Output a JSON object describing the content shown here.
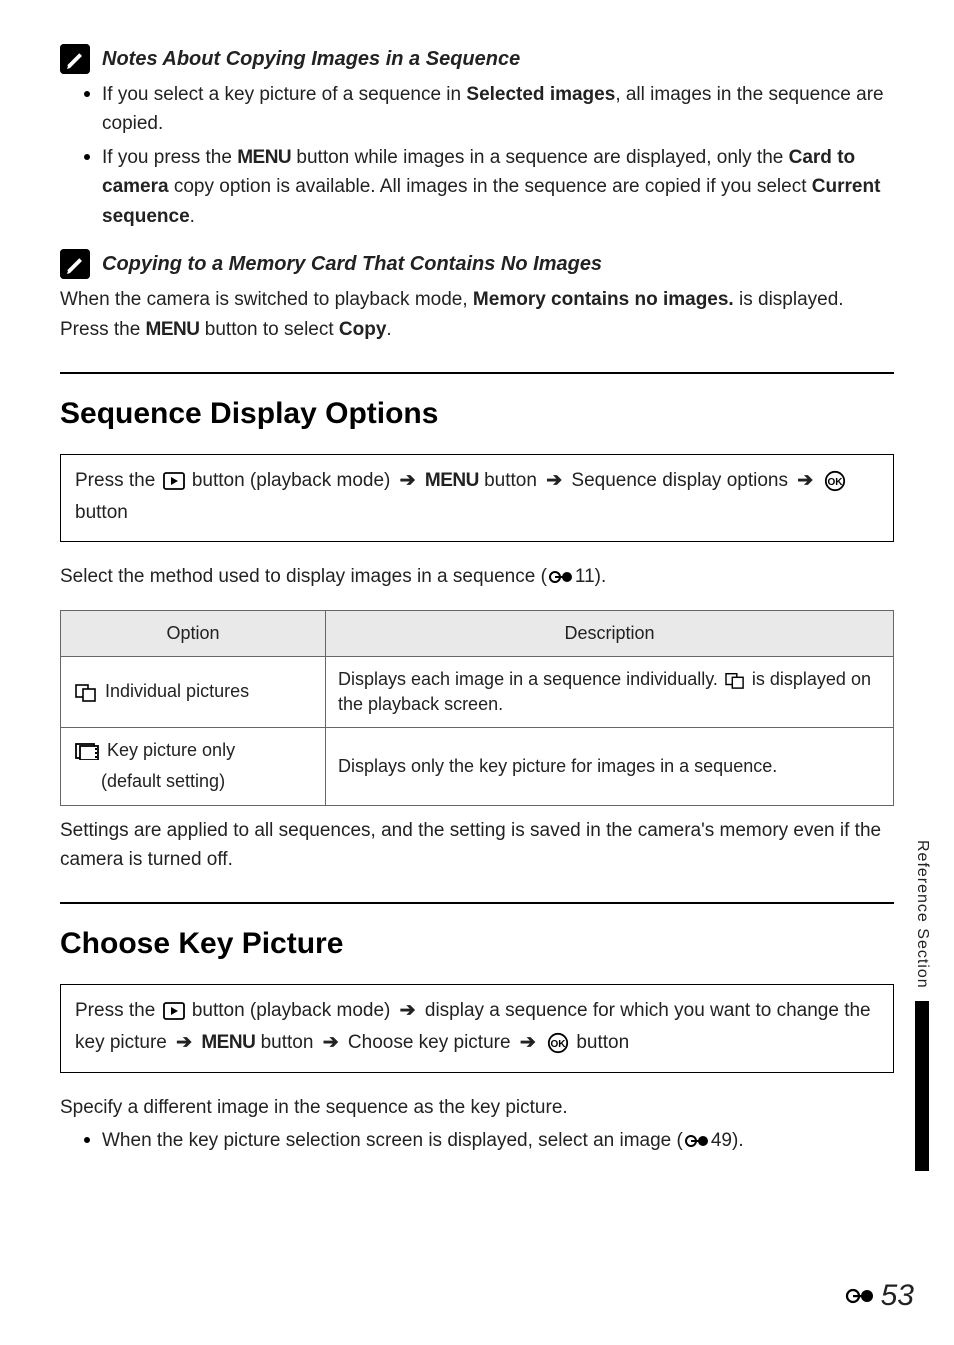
{
  "notes1": {
    "heading": "Notes About Copying Images in a Sequence",
    "item1_pre": "If you select a key picture of a sequence in ",
    "item1_bold": "Selected images",
    "item1_post": ", all images in the sequence are copied.",
    "item2_pre": "If you press the ",
    "item2_menu": "MENU",
    "item2_mid": " button while images in a sequence are displayed, only the ",
    "item2_bold1": "Card to camera",
    "item2_mid2": " copy option is available. All images in the sequence are copied if you select ",
    "item2_bold2": "Current sequence",
    "item2_post": "."
  },
  "notes2": {
    "heading": "Copying to a Memory Card That Contains No Images",
    "p_pre": "When the camera is switched to playback mode, ",
    "p_bold": "Memory contains no images.",
    "p_mid": " is displayed. Press the ",
    "p_menu": "MENU",
    "p_mid2": " button to select ",
    "p_bold2": "Copy",
    "p_post": "."
  },
  "sec1": {
    "title": "Sequence Display Options",
    "bc_pre": "Press the ",
    "bc_mid1": " button (playback mode) ",
    "bc_menu": "MENU",
    "bc_mid2": " button ",
    "bc_label": " Sequence display options ",
    "bc_ok": " button",
    "lead_pre": "Select the method used to display images in a sequence (",
    "lead_ref": "11).",
    "table": {
      "h1": "Option",
      "h2": "Description",
      "r1_label": "Individual pictures",
      "r1_desc_pre": "Displays each image in a sequence individually. ",
      "r1_desc_post": " is displayed on the playback screen.",
      "r2_label_line1": "Key picture only",
      "r2_label_line2": "(default setting)",
      "r2_desc": "Displays only the key picture for images in a sequence."
    },
    "trailer": "Settings are applied to all sequences, and the setting is saved in the camera's memory even if the camera is turned off."
  },
  "sec2": {
    "title": "Choose Key Picture",
    "bc_pre": "Press the ",
    "bc_mid1": " button (playback mode) ",
    "bc_seq": " display a sequence for which you want to change the key picture ",
    "bc_menu": "MENU",
    "bc_mid2": " button ",
    "bc_label": " Choose key picture ",
    "bc_ok": " button",
    "lead": "Specify a different image in the sequence as the key picture.",
    "bullet_pre": "When the key picture selection screen is displayed, select an image (",
    "bullet_ref": "49)."
  },
  "side": {
    "label": "Reference Section"
  },
  "page": {
    "num": "53"
  }
}
